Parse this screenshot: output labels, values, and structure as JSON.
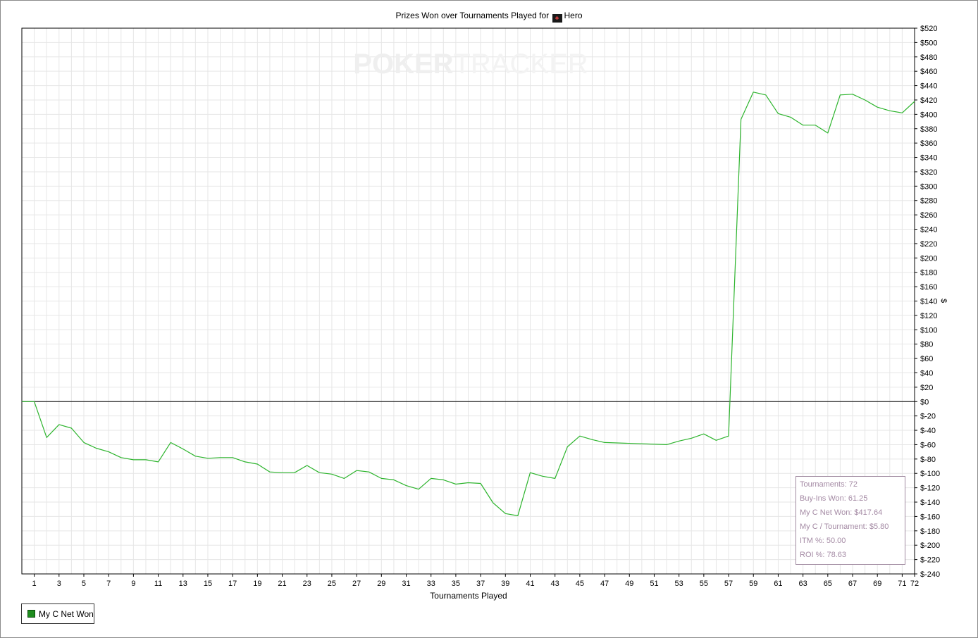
{
  "title": {
    "prefix": "Prizes Won over Tournaments Played for",
    "site_icon": "casino-site-icon",
    "player": "Hero"
  },
  "watermark": {
    "part1": "POKER",
    "part2": "TRACKER"
  },
  "stats": {
    "tournaments": "Tournaments: 72",
    "buyins_won": "Buy-Ins Won: 61.25",
    "net_won": "My C Net Won: $417.64",
    "per_tournament": "My C / Tournament: $5.80",
    "itm": "ITM %: 50.00",
    "roi": "ROI %: 78.63"
  },
  "legend": {
    "label": "My C Net Won"
  },
  "colors": {
    "line": "#2db42d",
    "grid": "#e6e6e6",
    "zero": "#000000",
    "stats_text": "#a48aa4"
  },
  "chart_data": {
    "type": "line",
    "title": "Prizes Won over Tournaments Played for Hero",
    "xlabel": "Tournaments Played",
    "ylabel": "$",
    "xlim": [
      0,
      72
    ],
    "ylim": [
      -240,
      520
    ],
    "grid": true,
    "legend_position": "bottom-left",
    "x_ticks": [
      1,
      3,
      5,
      7,
      9,
      11,
      13,
      15,
      17,
      19,
      21,
      23,
      25,
      27,
      29,
      31,
      33,
      35,
      37,
      39,
      41,
      43,
      45,
      47,
      49,
      51,
      53,
      55,
      57,
      59,
      61,
      63,
      65,
      67,
      69,
      71,
      72
    ],
    "y_ticks": [
      -240,
      -220,
      -200,
      -180,
      -160,
      -140,
      -120,
      -100,
      -80,
      -60,
      -40,
      -20,
      0,
      20,
      40,
      60,
      80,
      100,
      120,
      140,
      160,
      180,
      200,
      220,
      240,
      260,
      280,
      300,
      320,
      340,
      360,
      380,
      400,
      420,
      440,
      460,
      480,
      500,
      520
    ],
    "series": [
      {
        "name": "My C Net Won",
        "x": [
          0,
          1,
          2,
          3,
          4,
          5,
          6,
          7,
          8,
          9,
          10,
          11,
          12,
          13,
          14,
          15,
          16,
          17,
          18,
          19,
          20,
          21,
          22,
          23,
          24,
          25,
          26,
          27,
          28,
          29,
          30,
          31,
          32,
          33,
          34,
          35,
          36,
          37,
          38,
          39,
          40,
          41,
          42,
          43,
          44,
          45,
          46,
          47,
          52,
          53,
          54,
          55,
          56,
          57,
          58,
          59,
          60,
          61,
          62,
          63,
          64,
          65,
          66,
          67,
          68,
          69,
          70,
          71,
          72
        ],
        "values": [
          0,
          0,
          -50,
          -32,
          -37,
          -57,
          -65,
          -70,
          -78,
          -81,
          -81,
          -84,
          -57,
          -66,
          -76,
          -79,
          -78,
          -78,
          -84,
          -87,
          -98,
          -99,
          -99,
          -89,
          -99,
          -101,
          -107,
          -96,
          -98,
          -107,
          -109,
          -117,
          -122,
          -107,
          -109,
          -115,
          -113,
          -114,
          -141,
          -156,
          -159,
          -99,
          -104,
          -107,
          -63,
          -48,
          -53,
          -57,
          -60,
          -55,
          -51,
          -45,
          -54,
          -48,
          393,
          431,
          427,
          401,
          396,
          385,
          385,
          374,
          427,
          428,
          420,
          410,
          405,
          402,
          418
        ]
      }
    ]
  }
}
